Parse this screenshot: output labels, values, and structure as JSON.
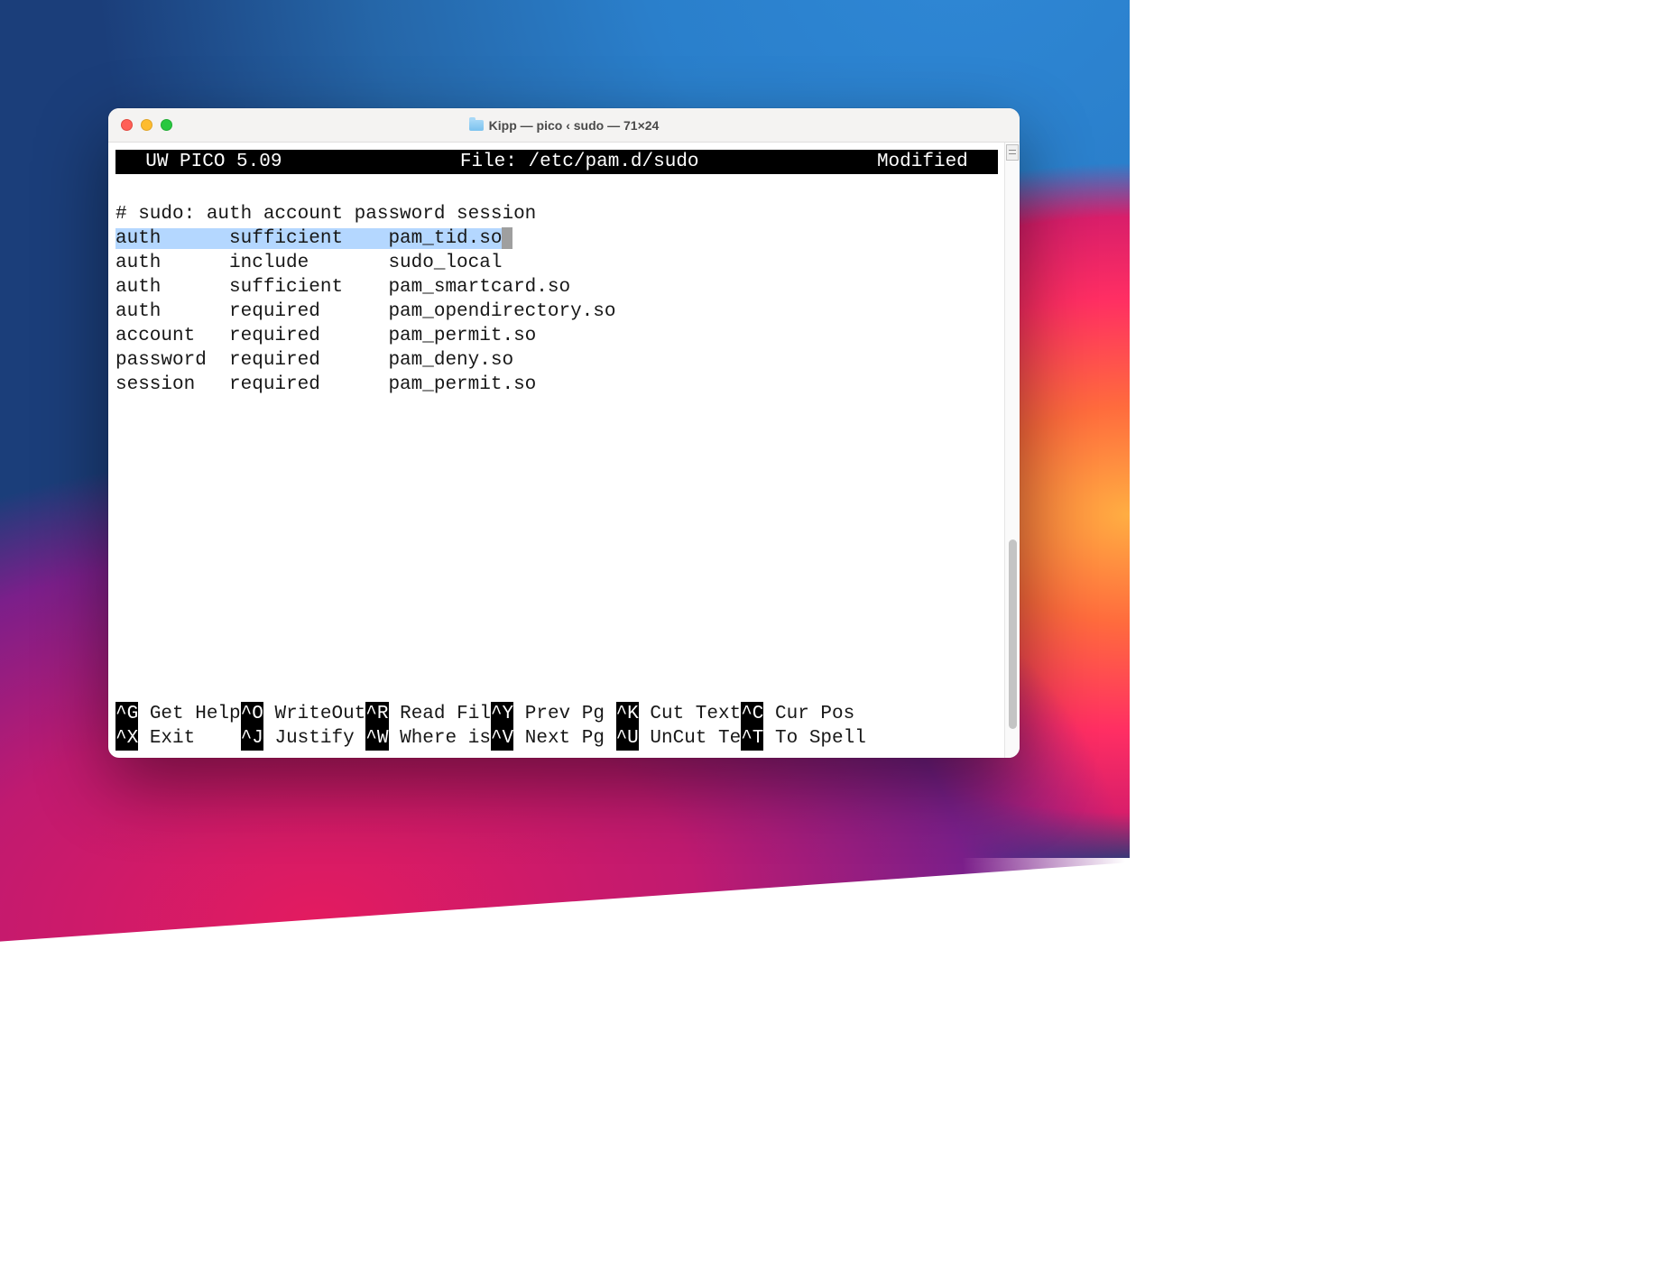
{
  "titlebar": {
    "title": "Kipp — pico ‹ sudo — 71×24"
  },
  "pico": {
    "app_label": "UW PICO 5.09",
    "file_prefix": "File: ",
    "file_path": "/etc/pam.d/sudo",
    "modified_label": "Modified",
    "comment_line": "# sudo: auth account password session",
    "selected_line": {
      "col1": "auth",
      "col2": "sufficient",
      "col3": "pam_tid.so"
    },
    "lines": [
      {
        "col1": "auth",
        "col2": "include",
        "col3": "sudo_local"
      },
      {
        "col1": "auth",
        "col2": "sufficient",
        "col3": "pam_smartcard.so"
      },
      {
        "col1": "auth",
        "col2": "required",
        "col3": "pam_opendirectory.so"
      },
      {
        "col1": "account",
        "col2": "required",
        "col3": "pam_permit.so"
      },
      {
        "col1": "password",
        "col2": "required",
        "col3": "pam_deny.so"
      },
      {
        "col1": "session",
        "col2": "required",
        "col3": "pam_permit.so"
      }
    ],
    "help_row1": [
      {
        "key": "^G",
        "label": "Get Help"
      },
      {
        "key": "^O",
        "label": "WriteOut"
      },
      {
        "key": "^R",
        "label": "Read Fil"
      },
      {
        "key": "^Y",
        "label": "Prev Pg "
      },
      {
        "key": "^K",
        "label": "Cut Text"
      },
      {
        "key": "^C",
        "label": "Cur Pos "
      }
    ],
    "help_row2": [
      {
        "key": "^X",
        "label": "Exit    "
      },
      {
        "key": "^J",
        "label": "Justify "
      },
      {
        "key": "^W",
        "label": "Where is"
      },
      {
        "key": "^V",
        "label": "Next Pg "
      },
      {
        "key": "^U",
        "label": "UnCut Te"
      },
      {
        "key": "^T",
        "label": "To Spell"
      }
    ]
  }
}
